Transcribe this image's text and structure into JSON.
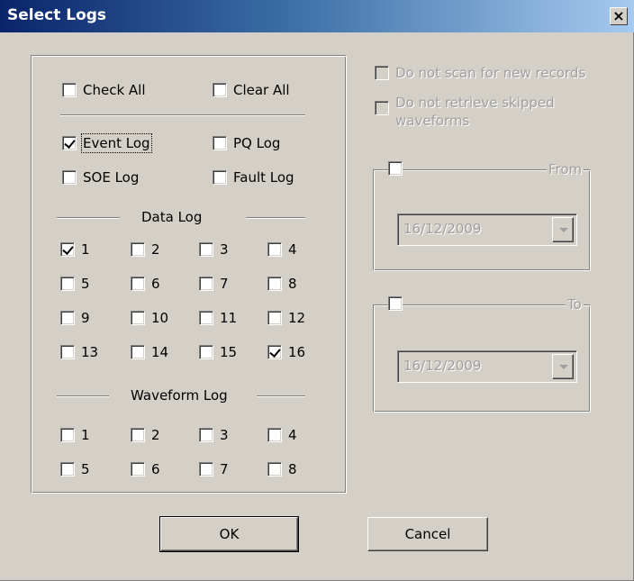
{
  "window": {
    "title": "Select Logs",
    "close_label": "×"
  },
  "top": {
    "check_all": "Check All",
    "clear_all": "Clear All"
  },
  "logs": {
    "event": {
      "label": "Event Log",
      "checked": true
    },
    "pq": {
      "label": "PQ Log",
      "checked": false
    },
    "soe": {
      "label": "SOE Log",
      "checked": false
    },
    "fault": {
      "label": "Fault Log",
      "checked": false
    }
  },
  "data_log": {
    "heading": "Data Log",
    "items": [
      {
        "label": "1",
        "checked": true
      },
      {
        "label": "2",
        "checked": false
      },
      {
        "label": "3",
        "checked": false
      },
      {
        "label": "4",
        "checked": false
      },
      {
        "label": "5",
        "checked": false
      },
      {
        "label": "6",
        "checked": false
      },
      {
        "label": "7",
        "checked": false
      },
      {
        "label": "8",
        "checked": false
      },
      {
        "label": "9",
        "checked": false
      },
      {
        "label": "10",
        "checked": false
      },
      {
        "label": "11",
        "checked": false
      },
      {
        "label": "12",
        "checked": false
      },
      {
        "label": "13",
        "checked": false
      },
      {
        "label": "14",
        "checked": false
      },
      {
        "label": "15",
        "checked": false
      },
      {
        "label": "16",
        "checked": true
      }
    ]
  },
  "waveform_log": {
    "heading": "Waveform Log",
    "items": [
      {
        "label": "1",
        "checked": false
      },
      {
        "label": "2",
        "checked": false
      },
      {
        "label": "3",
        "checked": false
      },
      {
        "label": "4",
        "checked": false
      },
      {
        "label": "5",
        "checked": false
      },
      {
        "label": "6",
        "checked": false
      },
      {
        "label": "7",
        "checked": false
      },
      {
        "label": "8",
        "checked": false
      }
    ]
  },
  "options": {
    "no_scan": "Do not scan for new records",
    "no_retrieve_line1": "Do not retrieve skipped",
    "no_retrieve_line2": "waveforms"
  },
  "from": {
    "legend": "From",
    "date": "16/12/2009"
  },
  "to": {
    "legend": "To",
    "date": "16/12/2009"
  },
  "buttons": {
    "ok": "OK",
    "cancel": "Cancel"
  }
}
